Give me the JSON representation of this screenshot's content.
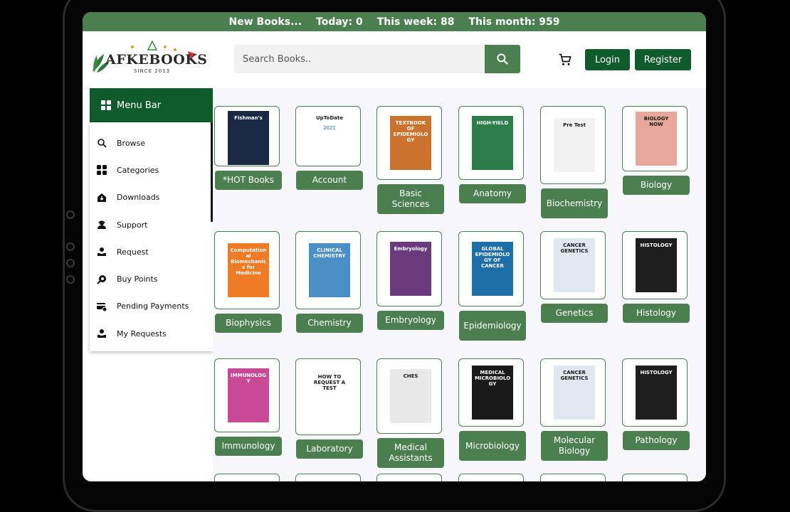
{
  "topbar": {
    "new_books": "New Books...",
    "today": "Today: 0",
    "week": "This week: 88",
    "month": "This month: 959"
  },
  "logo": {
    "name": "AFKEBOOKS",
    "since": "SINCE 2013"
  },
  "search": {
    "placeholder": "Search Books.."
  },
  "header": {
    "login": "Login",
    "register": "Register"
  },
  "colors": {
    "brand_green": "#4c7f4f",
    "dark_green": "#0f5b2c"
  },
  "menu": {
    "title": "Menu Bar",
    "items": [
      {
        "label": "Browse",
        "icon": "search-icon"
      },
      {
        "label": "Categories",
        "icon": "grid-icon"
      },
      {
        "label": "Downloads",
        "icon": "download-icon"
      },
      {
        "label": "Support",
        "icon": "support-icon"
      },
      {
        "label": "Request",
        "icon": "request-icon"
      },
      {
        "label": "Buy Points",
        "icon": "coin-icon"
      },
      {
        "label": "Pending Payments",
        "icon": "payment-icon"
      },
      {
        "label": "My Requests",
        "icon": "request-icon"
      }
    ]
  },
  "categories": [
    {
      "label": "*HOT Books",
      "cover_title": "Fishman's",
      "cover_color": "#1b2a44"
    },
    {
      "label": "Account",
      "cover_title": "UpToDate",
      "cover_sub": "2021",
      "cover_color": "#ffffff"
    },
    {
      "label": "Basic Sciences",
      "cover_title": "TEXTBOOK OF EPIDEMIOLOGY",
      "cover_color": "#c9732c"
    },
    {
      "label": "Anatomy",
      "cover_title": "HIGH-YIELD",
      "cover_color": "#2d7d4a"
    },
    {
      "label": "Biochemistry",
      "cover_title": "Pre Test",
      "cover_color": "#f2f2f2"
    },
    {
      "label": "Biology",
      "cover_title": "BIOLOGY NOW",
      "cover_color": "#e7a79a"
    },
    {
      "label": "Biophysics",
      "cover_title": "Computational Biomechanics for Medicine",
      "cover_color": "#ef7b26"
    },
    {
      "label": "Chemistry",
      "cover_title": "CLINICAL CHEMISTRY",
      "cover_color": "#4b8fc7"
    },
    {
      "label": "Embryology",
      "cover_title": "Embryology",
      "cover_color": "#6b3a7d"
    },
    {
      "label": "Epidemiology",
      "cover_title": "GLOBAL EPIDEMIOLOGY OF CANCER",
      "cover_color": "#1e6fa8"
    },
    {
      "label": "Genetics",
      "cover_title": "CANCER GENETICS",
      "cover_color": "#dfe8f1"
    },
    {
      "label": "Histology",
      "cover_title": "HISTOLOGY",
      "cover_color": "#1e1e1e"
    },
    {
      "label": "Immunology",
      "cover_title": "IMMUNOLOGY",
      "cover_color": "#c84a96"
    },
    {
      "label": "Laboratory",
      "cover_title": "HOW TO REQUEST A TEST",
      "cover_color": "#ffffff"
    },
    {
      "label": "Medical Assistants",
      "cover_title": "CHES",
      "cover_color": "#e8e8e8"
    },
    {
      "label": "Microbiology",
      "cover_title": "MEDICAL MICROBIOLOGY",
      "cover_color": "#1a1a1a"
    },
    {
      "label": "Molecular Biology",
      "cover_title": "CANCER GENETICS",
      "cover_color": "#dfe8f1"
    },
    {
      "label": "Pathology",
      "cover_title": "HISTOLOGY",
      "cover_color": "#1e1e1e"
    }
  ]
}
